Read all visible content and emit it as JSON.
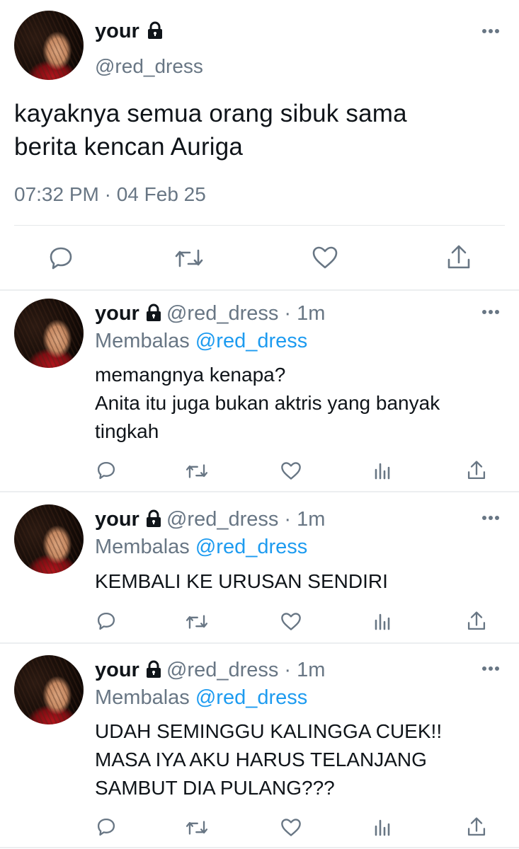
{
  "main_tweet": {
    "display_name": "your",
    "handle": "@red_dress",
    "text_line1": "kayaknya semua orang sibuk sama",
    "text_line2": "berita kencan Auriga",
    "timestamp": "07:32 PM · 04 Feb 25"
  },
  "replies": [
    {
      "display_name": "your",
      "handle_time": "@red_dress · 1m",
      "replying_prefix": "Membalas",
      "replying_to": "@red_dress",
      "lines": [
        "memangnya kenapa?",
        "Anita itu juga bukan aktris yang banyak",
        "tingkah"
      ]
    },
    {
      "display_name": "your",
      "handle_time": "@red_dress · 1m",
      "replying_prefix": "Membalas",
      "replying_to": "@red_dress",
      "lines": [
        "KEMBALI KE URUSAN SENDIRI"
      ]
    },
    {
      "display_name": "your",
      "handle_time": "@red_dress · 1m",
      "replying_prefix": "Membalas",
      "replying_to": "@red_dress",
      "lines": [
        "UDAH SEMINGGU KALINGGA CUEK!!",
        "MASA IYA AKU HARUS TELANJANG",
        "SAMBUT DIA PULANG???"
      ]
    }
  ],
  "icons": {
    "more": "more-horizontal-icon",
    "lock": "lock-icon",
    "reply": "reply-bubble-icon",
    "retweet": "retweet-icon",
    "like": "heart-icon",
    "views": "analytics-bars-icon",
    "share": "share-upload-icon"
  },
  "colors": {
    "text": "#0f1419",
    "muted": "#687684",
    "link": "#1d9bf0",
    "divider": "#eceef0"
  }
}
